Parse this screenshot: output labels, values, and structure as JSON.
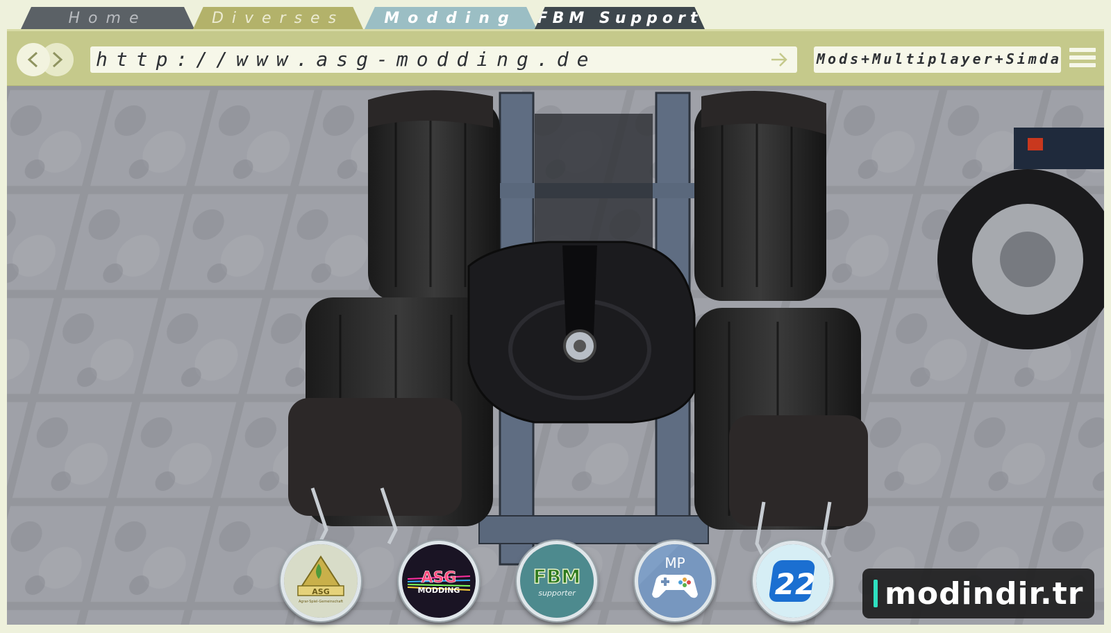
{
  "tabs": [
    {
      "label": "Home"
    },
    {
      "label": "Diverses"
    },
    {
      "label": "Modding"
    },
    {
      "label": "FBM Support"
    }
  ],
  "toolbar": {
    "url": "http://www.asg-modding.de",
    "search": "Mods+Multiplayer+Simdash"
  },
  "badges": {
    "asg_title": "ASG",
    "asg_sub": "Agrar-Spiel-Gemeinschaft",
    "asg_modding": "ASG",
    "asg_modding_sub": "MODDING",
    "fbm": "FBM",
    "fbm_sub": "supporter",
    "mp": "MP",
    "fs_version": "22"
  },
  "watermark": "modindir.tr",
  "colors": {
    "frame": "#c5c98b",
    "tab_active": "#9bbec4",
    "tab_fbm": "#3e474d",
    "accent": "#2ee0c0"
  }
}
